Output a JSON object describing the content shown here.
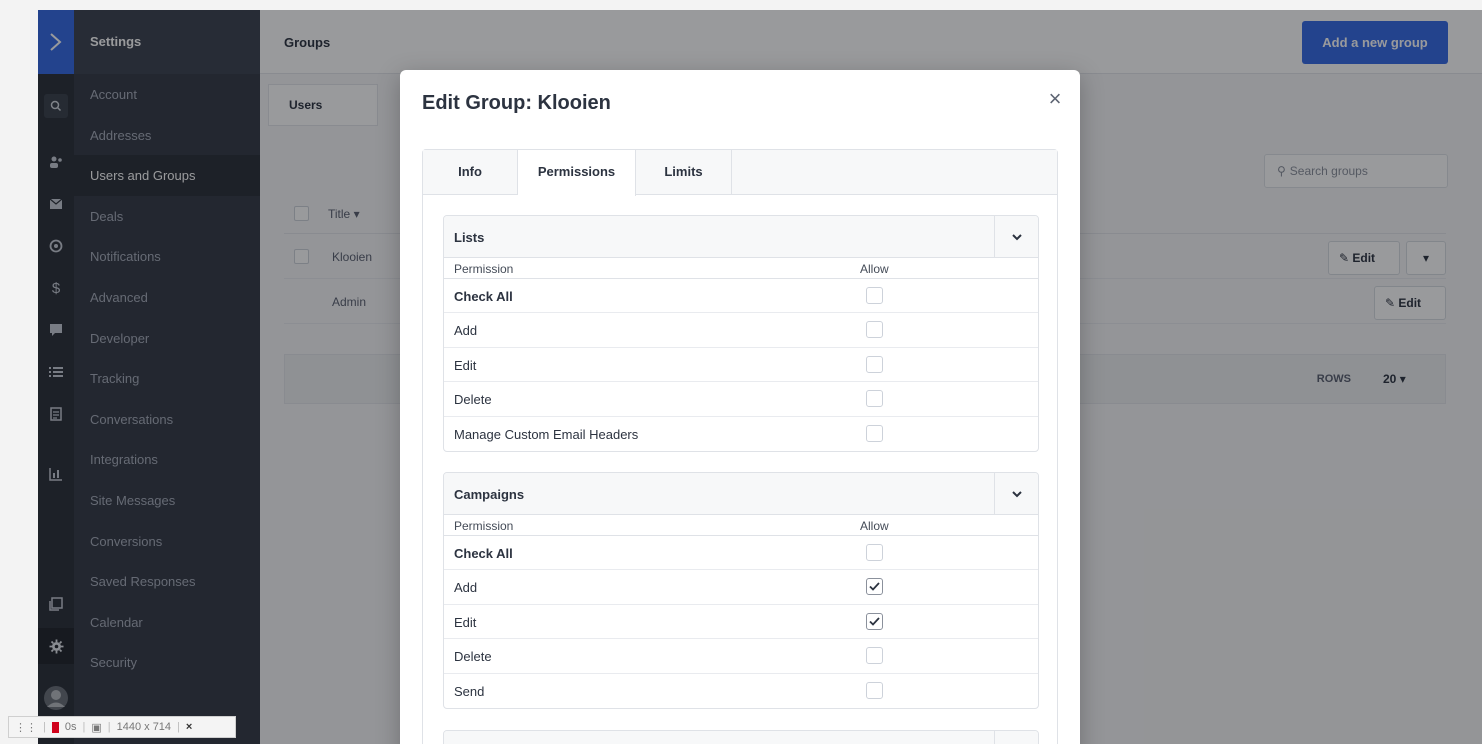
{
  "recorder": {
    "time": "0s",
    "size": "1440 x 714",
    "close": "×"
  },
  "settings_menu": {
    "title": "Settings",
    "items": [
      {
        "label": "Account"
      },
      {
        "label": "Addresses"
      },
      {
        "label": "Users and Groups",
        "active": true
      },
      {
        "label": "Deals"
      },
      {
        "label": "Notifications"
      },
      {
        "label": "Advanced"
      },
      {
        "label": "Developer"
      },
      {
        "label": "Tracking"
      },
      {
        "label": "Conversations"
      },
      {
        "label": "Integrations"
      },
      {
        "label": "Site Messages"
      },
      {
        "label": "Conversions"
      },
      {
        "label": "Saved Responses"
      },
      {
        "label": "Calendar"
      },
      {
        "label": "Security"
      }
    ]
  },
  "page": {
    "title": "Groups",
    "add_button": "Add a new group",
    "tab_users": "Users",
    "search_placeholder": "Search groups",
    "column_title": "Title",
    "rows": [
      {
        "name": "Klooien",
        "edit": "Edit"
      },
      {
        "name": "Admin",
        "edit": "Edit"
      }
    ],
    "rows_label": "ROWS",
    "rows_value": "20"
  },
  "modal": {
    "title": "Edit Group: Klooien",
    "close": "×",
    "tabs": [
      {
        "label": "Info"
      },
      {
        "label": "Permissions",
        "active": true
      },
      {
        "label": "Limits"
      }
    ],
    "sections": [
      {
        "title": "Lists",
        "col_permission": "Permission",
        "col_allow": "Allow",
        "rows": [
          {
            "label": "Check All",
            "checked": false,
            "bold": true
          },
          {
            "label": "Add",
            "checked": false
          },
          {
            "label": "Edit",
            "checked": false
          },
          {
            "label": "Delete",
            "checked": false
          },
          {
            "label": "Manage Custom Email Headers",
            "checked": false
          }
        ]
      },
      {
        "title": "Campaigns",
        "col_permission": "Permission",
        "col_allow": "Allow",
        "rows": [
          {
            "label": "Check All",
            "checked": false,
            "bold": true
          },
          {
            "label": "Add",
            "checked": true
          },
          {
            "label": "Edit",
            "checked": true
          },
          {
            "label": "Delete",
            "checked": false
          },
          {
            "label": "Send",
            "checked": false
          }
        ]
      }
    ]
  }
}
